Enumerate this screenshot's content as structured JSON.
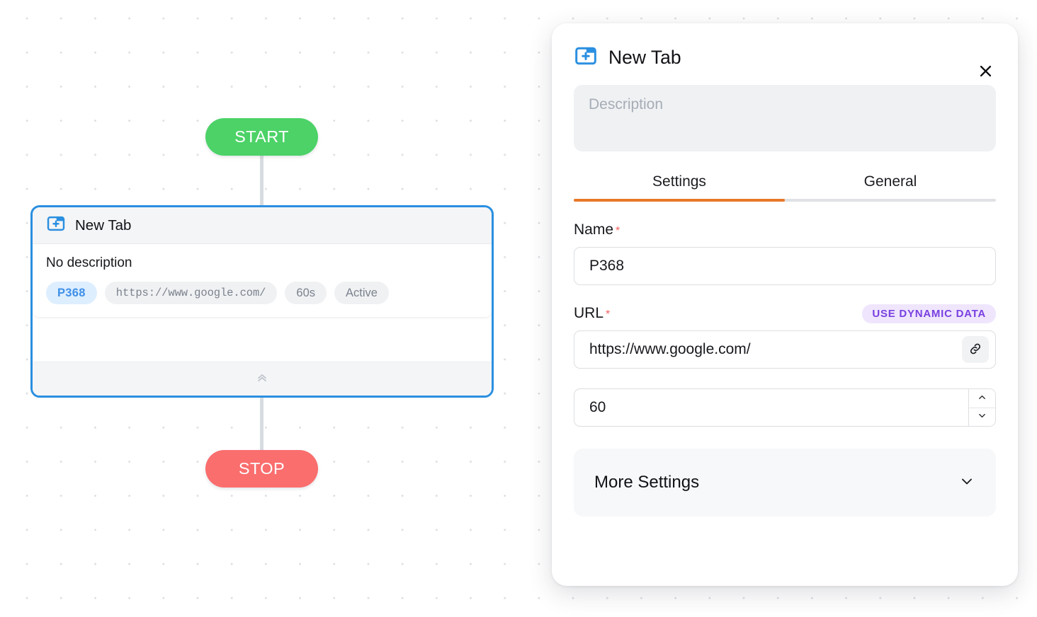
{
  "canvas": {
    "start_node": {
      "label": "START",
      "color": "#4cd267"
    },
    "stop_node": {
      "label": "STOP",
      "color": "#fa6e6e"
    },
    "node": {
      "icon": "new-tab-icon",
      "title": "New Tab",
      "description": "No description",
      "chips": [
        {
          "label": "P368",
          "style": "accent"
        },
        {
          "label": "https://www.google.com/",
          "style": "mono"
        },
        {
          "label": "60s",
          "style": "default"
        },
        {
          "label": "Active",
          "style": "default"
        }
      ],
      "collapse_icon": "chevrons-up-icon",
      "selected_border_color": "#2a8fe0"
    }
  },
  "panel": {
    "icon": "new-tab-icon",
    "title": "New Tab",
    "close_icon": "close-icon",
    "description": {
      "value": "",
      "placeholder": "Description"
    },
    "tabs": [
      {
        "label": "Settings",
        "active": true
      },
      {
        "label": "General",
        "active": false
      }
    ],
    "active_tab_color": "#e8792a",
    "fields": {
      "name": {
        "label": "Name",
        "required_marker": "*",
        "value": "P368"
      },
      "url": {
        "label": "URL",
        "required_marker": "*",
        "value": "https://www.google.com/",
        "link_icon": "link-icon",
        "dynamic_data_button": "USE DYNAMIC DATA",
        "dynamic_data_color": "#7940e0"
      },
      "timeout": {
        "value": "60",
        "increment_icon": "chevron-up-icon",
        "decrement_icon": "chevron-down-icon"
      }
    },
    "more_settings": {
      "label": "More Settings",
      "expand_icon": "chevron-down-icon"
    }
  }
}
